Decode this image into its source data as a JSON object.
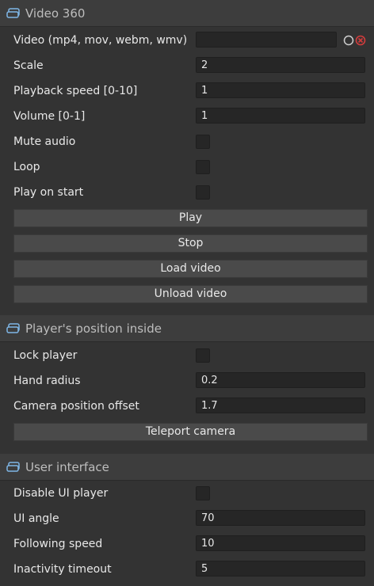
{
  "sections": [
    {
      "title": "Video 360",
      "rows": [
        {
          "label": "Video (mp4, mov, webm, wmv)",
          "value": ""
        },
        {
          "label": "Scale",
          "value": "2"
        },
        {
          "label": "Playback speed [0-10]",
          "value": "1"
        },
        {
          "label": "Volume [0-1]",
          "value": "1"
        },
        {
          "label": "Mute audio"
        },
        {
          "label": "Loop"
        },
        {
          "label": "Play on start"
        }
      ],
      "buttons": [
        "Play",
        "Stop",
        "Load video",
        "Unload video"
      ]
    },
    {
      "title": "Player's position inside",
      "rows": [
        {
          "label": "Lock player"
        },
        {
          "label": "Hand radius",
          "value": "0.2"
        },
        {
          "label": "Camera position offset",
          "value": "1.7"
        }
      ],
      "buttons": [
        "Teleport camera"
      ]
    },
    {
      "title": "User interface",
      "rows": [
        {
          "label": "Disable UI player"
        },
        {
          "label": "UI angle",
          "value": "70"
        },
        {
          "label": "Following speed",
          "value": "10"
        },
        {
          "label": "Inactivity timeout",
          "value": "5"
        }
      ]
    }
  ],
  "colors": {
    "panel": "#333333",
    "header": "#3d3d3d",
    "button": "#4a4a4a",
    "field": "#262626",
    "clear_icon": "#d23c3c"
  }
}
